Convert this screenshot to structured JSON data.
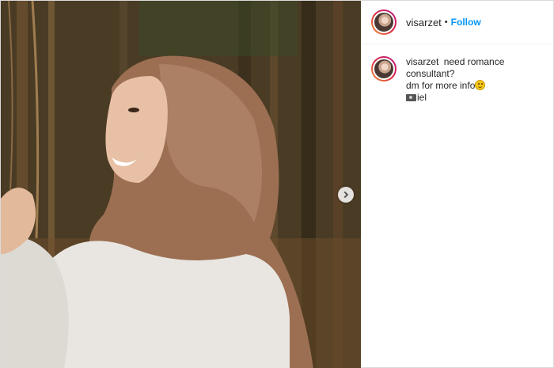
{
  "post": {
    "username": "visarzet",
    "separator": "•",
    "follow_label": "Follow",
    "caption": {
      "username": "visarzet",
      "line1": "need romance consultant?",
      "line2": "dm for more info",
      "line3": "iel",
      "emoji_after_line2": "smile-emoji",
      "emoji_before_line3": "camera-emoji"
    },
    "media": {
      "next_button_icon": "chevron-right-icon"
    }
  }
}
